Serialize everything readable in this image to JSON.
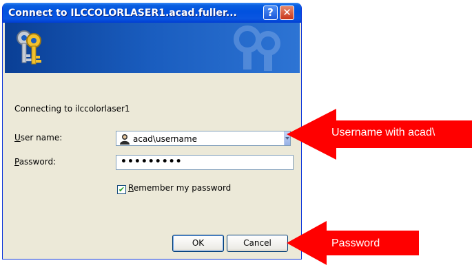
{
  "dialog": {
    "title": "Connect to ILCCOLORLASER1.acad.fuller...",
    "help_label": "?",
    "close_label": "✕",
    "connecting_text": "Connecting to ilccolorlaser1",
    "username_label_key": "U",
    "username_label_rest": "ser name:",
    "username_value": "acad\\username",
    "password_label_key": "P",
    "password_label_rest": "assword:",
    "password_value": "•••••••••",
    "remember_label_key": "R",
    "remember_label_rest": "emember my password",
    "remember_checked": "✔",
    "ok_label": "OK",
    "cancel_label": "Cancel"
  },
  "annotations": {
    "username_callout": "Username with acad\\",
    "password_callout": "Password",
    "callout_color": "#ff0000"
  }
}
